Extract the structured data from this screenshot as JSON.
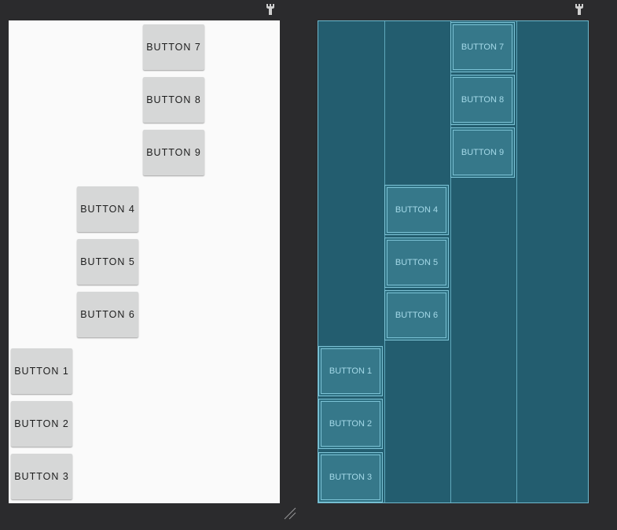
{
  "colors": {
    "workspace_bg": "#2b2b2d",
    "design_canvas_bg": "#fafafa",
    "button_bg": "#d6d7d7",
    "button_text": "#1e1e1e",
    "blueprint_bg": "#235d6f",
    "blueprint_line": "#7cc3d6",
    "blueprint_text": "#a4d9e8"
  },
  "toolbar": {
    "design_wrench_icon": "wrench-icon",
    "blueprint_wrench_icon": "wrench-icon"
  },
  "design": {
    "buttons": [
      {
        "label": "BUTTON 7"
      },
      {
        "label": "BUTTON 8"
      },
      {
        "label": "BUTTON 9"
      },
      {
        "label": "BUTTON 4"
      },
      {
        "label": "BUTTON 5"
      },
      {
        "label": "BUTTON 6"
      },
      {
        "label": "BUTTON 1"
      },
      {
        "label": "BUTTON 2"
      },
      {
        "label": "BUTTON 3"
      }
    ]
  },
  "blueprint": {
    "buttons": [
      {
        "label": "BUTTON 7"
      },
      {
        "label": "BUTTON 8"
      },
      {
        "label": "BUTTON 9"
      },
      {
        "label": "BUTTON 4"
      },
      {
        "label": "BUTTON 5"
      },
      {
        "label": "BUTTON 6"
      },
      {
        "label": "BUTTON 1"
      },
      {
        "label": "BUTTON 2"
      },
      {
        "label": "BUTTON 3"
      }
    ]
  },
  "resize_handle_icon": "resize-handle-icon"
}
